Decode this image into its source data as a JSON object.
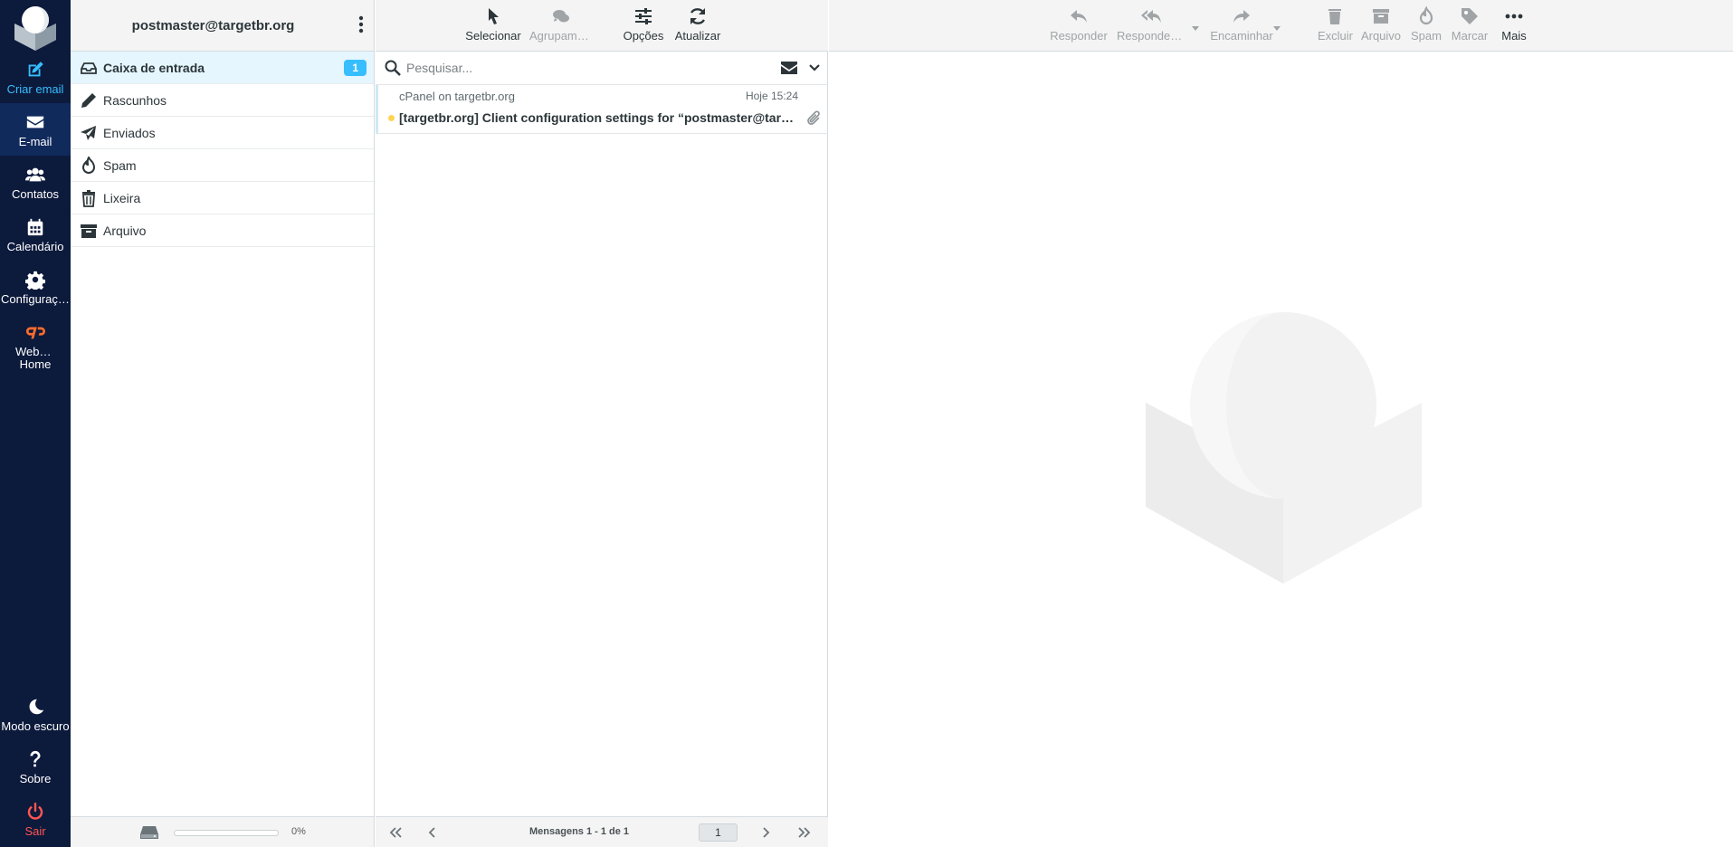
{
  "nav": {
    "items": [
      {
        "id": "compose",
        "label": "Criar email"
      },
      {
        "id": "mail",
        "label": "E-mail"
      },
      {
        "id": "contacts",
        "label": "Contatos"
      },
      {
        "id": "calendar",
        "label": "Calendário"
      },
      {
        "id": "settings",
        "label": "Configurações"
      },
      {
        "id": "webmail-home",
        "label": "Webmail Home"
      },
      {
        "id": "dark-mode",
        "label": "Modo escuro"
      },
      {
        "id": "about",
        "label": "Sobre"
      },
      {
        "id": "logout",
        "label": "Sair"
      }
    ]
  },
  "folders": {
    "account": "postmaster@targetbr.org",
    "items": [
      {
        "label": "Caixa de entrada",
        "icon": "inbox-icon",
        "unread": "1"
      },
      {
        "label": "Rascunhos",
        "icon": "pencil-icon"
      },
      {
        "label": "Enviados",
        "icon": "paper-plane-icon"
      },
      {
        "label": "Spam",
        "icon": "fire-icon"
      },
      {
        "label": "Lixeira",
        "icon": "trash-icon"
      },
      {
        "label": "Arquivo",
        "icon": "archive-icon"
      }
    ],
    "quota": {
      "percent_label": "0%",
      "fraction": 0
    }
  },
  "list_toolbar": {
    "select": "Selecionar",
    "threads": "Agrupamento",
    "options": "Opções",
    "refresh": "Atualizar"
  },
  "search": {
    "placeholder": "Pesquisar..."
  },
  "messages": [
    {
      "from": "cPanel on targetbr.org",
      "date": "Hoje 15:24",
      "subject": "[targetbr.org] Client configuration settings for “postmaster@targetbr.org”.",
      "unread": true,
      "has_attachment": true
    }
  ],
  "list_footer": {
    "count": "Mensagens 1 - 1 de 1",
    "page": "1"
  },
  "preview_toolbar": {
    "reply": "Responder",
    "reply_all": "Responder a todos",
    "forward": "Encaminhar",
    "delete": "Excluir",
    "archive": "Arquivo",
    "spam": "Spam",
    "mark": "Marcar",
    "more": "Mais"
  },
  "colors": {
    "nav_bg": "#0c1a3c",
    "accent": "#37beff",
    "logout": "#ff5552",
    "unread_dot": "#ffd452"
  }
}
